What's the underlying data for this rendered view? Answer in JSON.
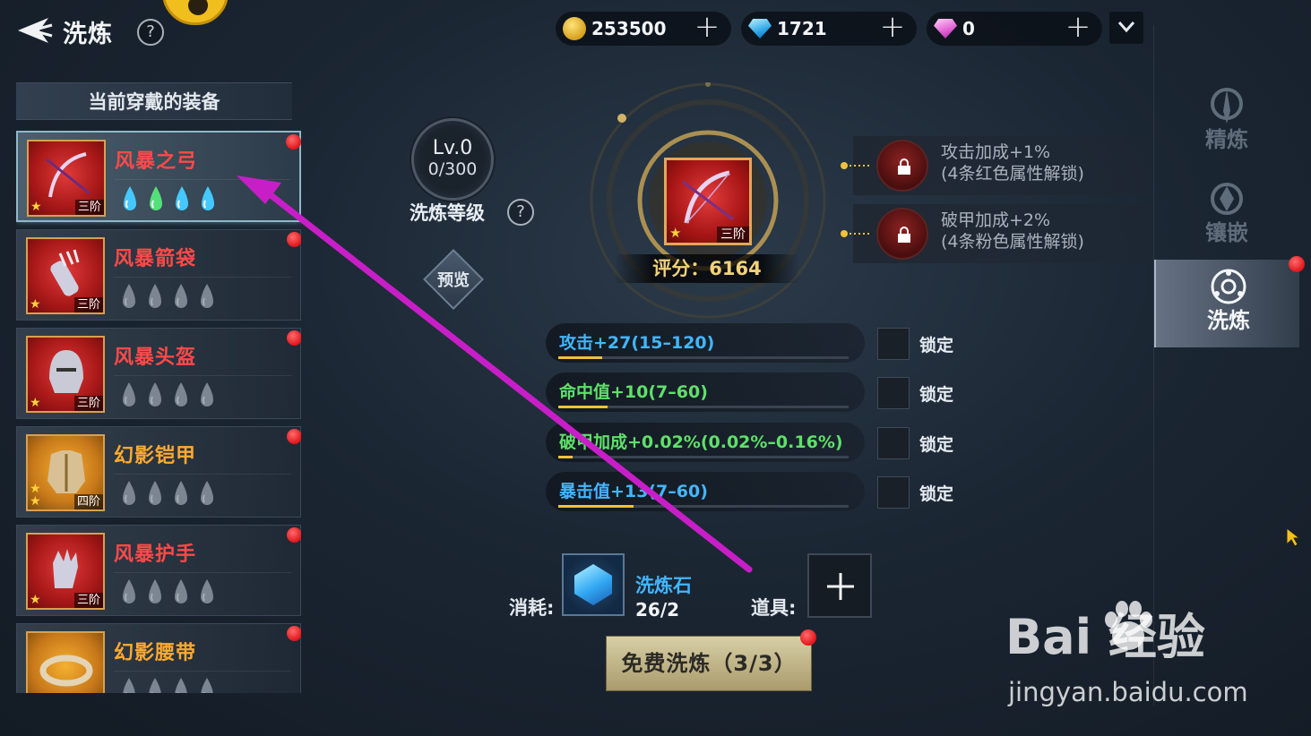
{
  "header": {
    "title": "洗炼",
    "help": "?"
  },
  "currencies": [
    {
      "icon": "gold-coin-icon",
      "value": "253500",
      "plus": "+"
    },
    {
      "icon": "diamond-icon",
      "value": "1721",
      "plus": "+"
    },
    {
      "icon": "pink-gem-icon",
      "value": "0",
      "plus": "+"
    }
  ],
  "equipment": {
    "header": "当前穿戴的装备",
    "items": [
      {
        "name": "风暴之弓",
        "tier": "三阶",
        "stars": 1,
        "color": "red",
        "drops_lit": 4,
        "selected": true
      },
      {
        "name": "风暴箭袋",
        "tier": "三阶",
        "stars": 1,
        "color": "red",
        "drops_lit": 0
      },
      {
        "name": "风暴头盔",
        "tier": "三阶",
        "stars": 1,
        "color": "red",
        "drops_lit": 0
      },
      {
        "name": "幻影铠甲",
        "tier": "四阶",
        "stars": 2,
        "color": "gold",
        "drops_lit": 0
      },
      {
        "name": "风暴护手",
        "tier": "三阶",
        "stars": 1,
        "color": "red",
        "drops_lit": 0
      },
      {
        "name": "幻影腰带",
        "tier": "",
        "stars": 1,
        "color": "gold",
        "drops_lit": 0
      }
    ]
  },
  "wash_level": {
    "level": "Lv.0",
    "progress": "0/300",
    "label": "洗炼等级",
    "help": "?"
  },
  "preview": {
    "label": "预览"
  },
  "center_item": {
    "tier": "三阶",
    "score": "评分：6164"
  },
  "bonuses": [
    {
      "line1": "攻击加成+1%",
      "line2": "(4条红色属性解锁)"
    },
    {
      "line1": "破甲加成+2%",
      "line2": "(4条粉色属性解锁)"
    }
  ],
  "stats": [
    {
      "text": "攻击+27(15–120)",
      "color": "blue",
      "fill_fraction": 0.15,
      "lock_label": "锁定"
    },
    {
      "text": "命中值+10(7–60)",
      "color": "green",
      "fill_fraction": 0.17,
      "lock_label": "锁定"
    },
    {
      "text": "破甲加成+0.02%(0.02%–0.16%)",
      "color": "green",
      "fill_fraction": 0.05,
      "lock_label": "锁定"
    },
    {
      "text": "暴击值+13(7–60)",
      "color": "blue",
      "fill_fraction": 0.26,
      "lock_label": "锁定"
    }
  ],
  "consume": {
    "label": "消耗:",
    "item_name": "洗炼石",
    "item_count": "26/2",
    "prop_label": "道具:"
  },
  "action": {
    "free_wash": "免费洗炼（3/3）"
  },
  "side_tabs": [
    {
      "label": "精炼",
      "icon": "sword-emblem-icon",
      "active": false
    },
    {
      "label": "镶嵌",
      "icon": "inlay-emblem-icon",
      "active": false
    },
    {
      "label": "洗炼",
      "icon": "wash-emblem-icon",
      "active": true
    }
  ],
  "watermark": {
    "logo": "Bai  经验",
    "url": "jingyan.baidu.com"
  },
  "colors": {
    "accent_red": "#e0151b",
    "gold": "#f0c23a",
    "stat_blue": "#42b6ff",
    "stat_green": "#5fe06a",
    "annotation_arrow": "#c81ec8"
  }
}
